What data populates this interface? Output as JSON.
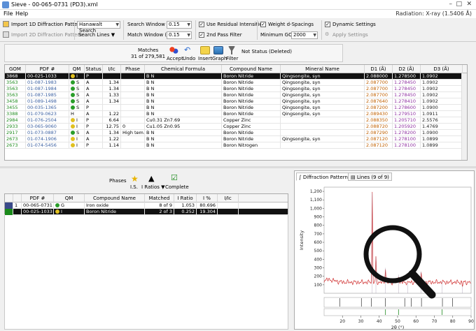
{
  "window": {
    "title": "Sieve  -  00-065-0731 (PD3).xml"
  },
  "menu": {
    "file": "File",
    "help": "Help",
    "radiation": "Radiation: X-ray (1.5406 Å)"
  },
  "toolbar": {
    "import_1d": "Import 1D Diffraction Pattern",
    "import_2d": "Import 2D Diffraction Pattern",
    "search_type": "Hanawalt Search",
    "search_lines": "Search Lines ▼",
    "search_window_label": "Search Window (°):",
    "search_window_value": "0.15",
    "match_window_label": "Match Window (°):",
    "match_window_value": "0.15",
    "use_residual": "Use Residual Intensities",
    "second_pass": "2nd Pass Filter",
    "weight_d": "Weight d-Spacings",
    "min_gom_label": "Minimum GOM:",
    "min_gom_value": "2000",
    "dynamic_settings": "Dynamic Settings",
    "apply_settings": "Apply Settings"
  },
  "matches": {
    "label": "Matches",
    "count": "31 of 279,581",
    "accept": "Accept",
    "undo": "Undo",
    "insert": "Insert",
    "graph": "Graph",
    "filter": "Filter",
    "status": "Not Status (Deleted)"
  },
  "match_table": {
    "columns": [
      "GOM",
      "PDF #",
      "QM",
      "Status",
      "I/Ic",
      "Phase",
      "Chemical Formula",
      "Compound Name",
      "Mineral Name",
      "D1 (Å)",
      "D2 (Å)",
      "D3 (Å)"
    ],
    "rows": [
      {
        "gom": "3868",
        "pdf": "00-025-1033",
        "qm": "I",
        "qmc": "#e0c020",
        "status": "P",
        "iic": "",
        "phase": "",
        "formula": "B N",
        "compound": "Boron Nitride",
        "mineral": "Qingsongite, syn",
        "d1": "2.088000",
        "d2": "1.278500",
        "d3": "1.0902"
      },
      {
        "gom": "3563",
        "pdf": "01-087-1983",
        "qm": "S",
        "qmc": "#2a9d2a",
        "status": "A",
        "iic": "1.34",
        "phase": "",
        "formula": "B N",
        "compound": "Boron Nitride",
        "mineral": "Qingsongite, syn",
        "d1": "2.087700",
        "d2": "1.278450",
        "d3": "1.0902"
      },
      {
        "gom": "3563",
        "pdf": "01-087-1984",
        "qm": "S",
        "qmc": "#2a9d2a",
        "status": "A",
        "iic": "1.34",
        "phase": "",
        "formula": "B N",
        "compound": "Boron Nitride",
        "mineral": "Qingsongite, syn",
        "d1": "2.087700",
        "d2": "1.278450",
        "d3": "1.0902"
      },
      {
        "gom": "3563",
        "pdf": "01-087-1985",
        "qm": "S",
        "qmc": "#2a9d2a",
        "status": "A",
        "iic": "1.33",
        "phase": "",
        "formula": "B N",
        "compound": "Boron Nitride",
        "mineral": "Qingsongite, syn",
        "d1": "2.087700",
        "d2": "1.278450",
        "d3": "1.0902"
      },
      {
        "gom": "3458",
        "pdf": "01-089-1498",
        "qm": "S",
        "qmc": "#2a9d2a",
        "status": "A",
        "iic": "1.34",
        "phase": "",
        "formula": "B N",
        "compound": "Boron Nitride",
        "mineral": "Qingsongite, syn",
        "d1": "2.087640",
        "d2": "1.278410",
        "d3": "1.0902"
      },
      {
        "gom": "3455",
        "pdf": "00-035-1365",
        "qm": "S",
        "qmc": "#2a9d2a",
        "status": "P",
        "iic": "",
        "phase": "",
        "formula": "B N",
        "compound": "Boron Nitride",
        "mineral": "Qingsongite, syn",
        "d1": "2.087200",
        "d2": "1.278600",
        "d3": "1.0900"
      },
      {
        "gom": "3388",
        "pdf": "01-079-0623",
        "qm": "H",
        "qmc": "",
        "status": "A",
        "iic": "1.22",
        "phase": "",
        "formula": "B N",
        "compound": "Boron Nitride",
        "mineral": "Qingsongite, syn",
        "d1": "2.089430",
        "d2": "1.279510",
        "d3": "1.0911"
      },
      {
        "gom": "2984",
        "pdf": "01-076-2504",
        "qm": "I",
        "qmc": "#e0c020",
        "status": "P",
        "iic": "6.64",
        "phase": "",
        "formula": "Cu0.31 Zn7.69",
        "compound": "Copper Zinc",
        "mineral": "",
        "d1": "2.088350",
        "d2": "1.205710",
        "d3": "2.5576"
      },
      {
        "gom": "2933",
        "pdf": "03-065-9060",
        "qm": "I",
        "qmc": "#e0c020",
        "status": "P",
        "iic": "12.75",
        "phase": "0",
        "formula": "Cu1.05 Zn0.95",
        "compound": "Copper Zinc",
        "mineral": "",
        "d1": "2.088720",
        "d2": "1.205920",
        "d3": "1.4769"
      },
      {
        "gom": "2917",
        "pdf": "01-073-0887",
        "qm": "S",
        "qmc": "#2a9d2a",
        "status": "A",
        "iic": "1.34",
        "phase": "High tem...",
        "formula": "B N",
        "compound": "Boron Nitride",
        "mineral": "",
        "d1": "2.087290",
        "d2": "1.278200",
        "d3": "1.0900"
      },
      {
        "gom": "2673",
        "pdf": "01-074-1906",
        "qm": "I",
        "qmc": "#e0c020",
        "status": "A",
        "iic": "1.22",
        "phase": "",
        "formula": "B N",
        "compound": "Boron Nitride",
        "mineral": "Qingsongite, syn",
        "d1": "2.087120",
        "d2": "1.278100",
        "d3": "1.0899"
      },
      {
        "gom": "2673",
        "pdf": "01-074-5456",
        "qm": "I",
        "qmc": "#e0c020",
        "status": "P",
        "iic": "1.14",
        "phase": "",
        "formula": "B N",
        "compound": "Boron Nitrogen",
        "mineral": "",
        "d1": "2.087120",
        "d2": "1.278100",
        "d3": "1.0899"
      }
    ]
  },
  "phases": {
    "label": "Phases",
    "is_label": "I.S.",
    "iratios_label": "I Ratios ▼",
    "complete_label": "Complete",
    "columns": [
      "PDF #",
      "QM",
      "Compound Name",
      "Matched",
      "I Ratio",
      "I %",
      "I/Ic"
    ],
    "rows": [
      {
        "num": "1",
        "pdf": "00-065-0731",
        "qm": "G",
        "qmc": "#2a9d2a",
        "compound": "Iron oxide",
        "matched": "8 of 9",
        "iratio": "1.053",
        "ipct": "80.696",
        "iic": "",
        "color": "#3a4a8a"
      },
      {
        "num": "",
        "pdf": "00-025-1033",
        "qm": "I",
        "qmc": "#e0c020",
        "compound": "Boron Nitride",
        "matched": "2 of 3",
        "iratio": "0.252",
        "ipct": "19.304",
        "iic": "",
        "color": "#1a8a1a"
      }
    ]
  },
  "chart_tabs": {
    "patterns": "Diffraction Patterns",
    "lines": "Lines (9 of 9)"
  },
  "chart_data": {
    "type": "line",
    "xlabel": "2θ (°)",
    "ylabel": "Intensity",
    "xlim": [
      10,
      90
    ],
    "ylim": [
      0,
      1250
    ],
    "x_ticks": [
      20,
      30,
      40,
      50,
      60,
      70,
      80,
      90
    ],
    "y_ticks": [
      100,
      200,
      300,
      400,
      500,
      600,
      700,
      800,
      900,
      1000,
      1100,
      1200
    ],
    "peaks": [
      {
        "x": 36.2,
        "y": 1180
      },
      {
        "x": 38.2,
        "y": 420
      },
      {
        "x": 43.4,
        "y": 300
      },
      {
        "x": 50.5,
        "y": 220
      },
      {
        "x": 55.5,
        "y": 120
      },
      {
        "x": 62.8,
        "y": 260
      },
      {
        "x": 74.2,
        "y": 140
      },
      {
        "x": 85.3,
        "y": 90
      }
    ],
    "background_level": 130,
    "ref_lines_black": [
      18.5,
      30.3,
      35.7,
      43.3,
      53.9,
      57.4,
      63.0,
      74.4,
      79.9
    ],
    "ref_lines_green": [
      43.4,
      50.5,
      74.2
    ]
  }
}
